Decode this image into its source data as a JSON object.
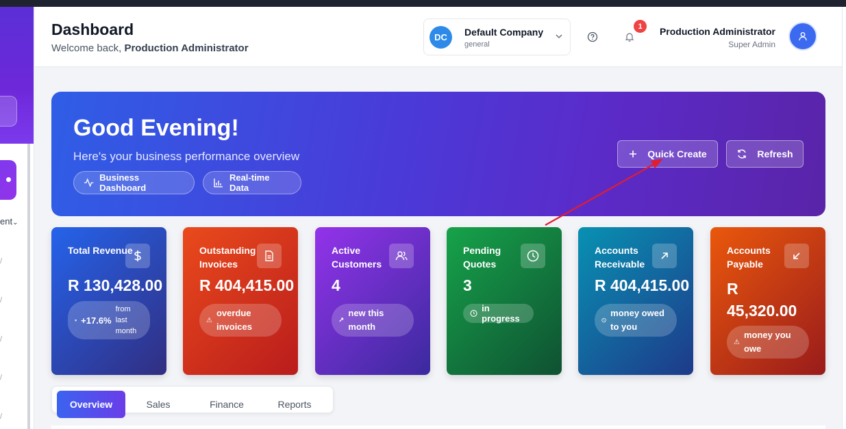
{
  "header": {
    "title": "Dashboard",
    "welcome_prefix": "Welcome back, ",
    "welcome_name": "Production Administrator",
    "company": {
      "initials": "DC",
      "name": "Default Company",
      "sub": "general"
    },
    "notifications_count": "1",
    "user": {
      "name": "Production Administrator",
      "role": "Super Admin"
    }
  },
  "sidebar": {
    "partial_label": "ent"
  },
  "hero": {
    "greeting": "Good Evening!",
    "subtitle": "Here's your business performance overview",
    "chips": [
      "Business Dashboard",
      "Real-time Data"
    ],
    "quick_create_label": "Quick Create",
    "refresh_label": "Refresh"
  },
  "cards": [
    {
      "label": "Total Revenue",
      "value": "R 130,428.00",
      "pill": "+17.6%",
      "pill_extra": "from last month",
      "icon": "dollar-icon",
      "colors": [
        "#2563eb",
        "#312e81"
      ]
    },
    {
      "label": "Outstanding Invoices",
      "value": "R 404,415.00",
      "pill": "overdue invoices",
      "icon": "document-icon",
      "colors": [
        "#ea4a1c",
        "#b91c1c"
      ]
    },
    {
      "label": "Active Customers",
      "value": "4",
      "pill": "new this month",
      "icon": "users-icon",
      "colors": [
        "#9333ea",
        "#3b2a9e"
      ]
    },
    {
      "label": "Pending Quotes",
      "value": "3",
      "pill": "in progress",
      "icon": "clock-icon",
      "colors": [
        "#16a34a",
        "#0f5132"
      ]
    },
    {
      "label": "Accounts Receivable",
      "value": "R 404,415.00",
      "pill": "money owed to you",
      "icon": "arrow-up-right-icon",
      "colors": [
        "#0891b2",
        "#1e3a8a"
      ]
    },
    {
      "label": "Accounts Payable",
      "value_line1": "R",
      "value_line2": "45,320.00",
      "pill": "money you owe",
      "icon": "arrow-down-left-icon",
      "colors": [
        "#ea580c",
        "#991b1b"
      ]
    }
  ],
  "tabs": [
    "Overview",
    "Sales",
    "Finance",
    "Reports"
  ],
  "annotation_color": "#e11d2e"
}
